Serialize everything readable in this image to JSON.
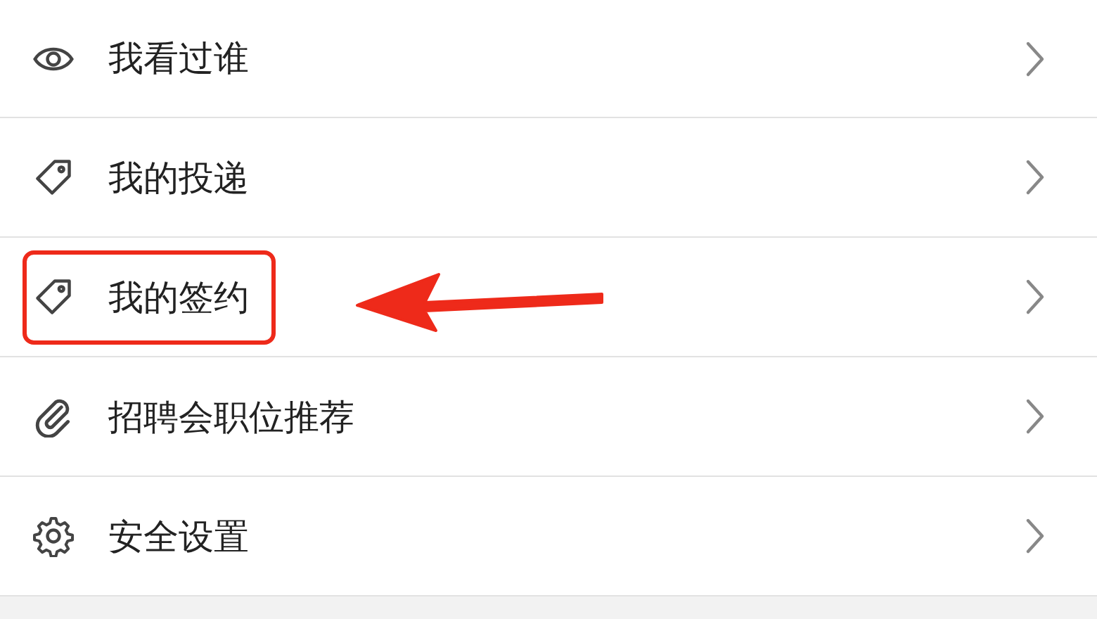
{
  "menu_items": [
    {
      "label": "我看过谁",
      "highlighted": false
    },
    {
      "label": "我的投递",
      "highlighted": false
    },
    {
      "label": "我的签约",
      "highlighted": true
    },
    {
      "label": "招聘会职位推荐",
      "highlighted": false
    },
    {
      "label": "安全设置",
      "highlighted": false
    }
  ]
}
